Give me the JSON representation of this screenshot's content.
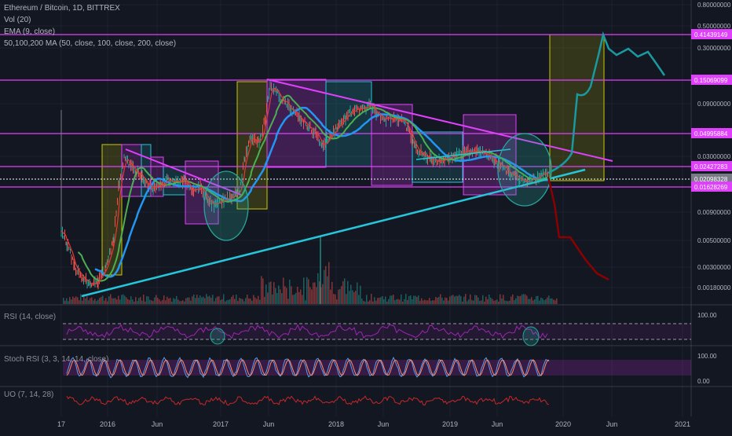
{
  "header": {
    "title": "Ethereum / Bitcoin, 1D, BITTREX",
    "indicators": [
      "Vol (20)",
      "EMA (9, close)",
      "50,100,200 MA (50, close, 100, close, 200, close)"
    ]
  },
  "panes": {
    "rsi_label": "RSI (14, close)",
    "stoch_label": "Stoch RSI (3, 3, 14, 14, close)",
    "uo_label": "UO (7, 14, 28)"
  },
  "colors": {
    "background": "#131722",
    "magenta": "#e040fb",
    "cyan": "#26c6da",
    "teal_projection": "#1a9aa0",
    "red_projection": "#8b0000",
    "ma_blue": "#2196f3",
    "ma_green": "#4caf50",
    "ema_red": "#e53935",
    "rsi": "#9c27b0",
    "stoch_k": "#5c9df0",
    "stoch_d": "#ff8a65",
    "uo": "#c62828",
    "yellow_box": "#c8c800"
  },
  "chart_data": {
    "type": "line",
    "scale": "log",
    "y_axis_ticks": [
      "0.80000000",
      "0.50000000",
      "0.30000000",
      "0.09000000",
      "0.03000000",
      "0.00900000",
      "0.00500000",
      "0.00300000",
      "0.00180000"
    ],
    "price_labels": [
      "0.41439149",
      "0.15069099",
      "0.04995884",
      "0.02427283",
      "0.02098328",
      "0.01628269"
    ],
    "x_axis_ticks": [
      "17",
      "2016",
      "Jun",
      "2017",
      "Jun",
      "2018",
      "Jun",
      "2019",
      "Jun",
      "2020",
      "Jun",
      "2021"
    ],
    "rsi_ticks": [
      "100.00"
    ],
    "stoch_ticks": [
      "100.00",
      "0.00"
    ],
    "horizontal_levels": [
      0.41439149,
      0.15069099,
      0.04995884,
      0.02427283,
      0.02098328,
      0.01628269
    ],
    "projections": [
      "bullish (teal)",
      "bearish (red)"
    ],
    "grid": true
  }
}
